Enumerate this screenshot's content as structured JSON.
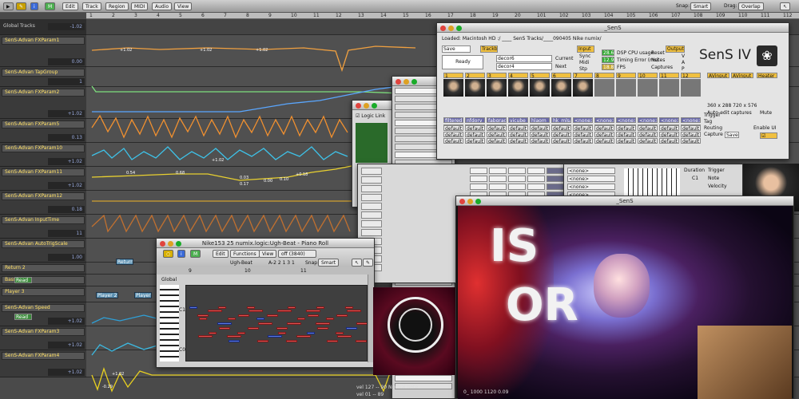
{
  "toolbar": {
    "edit": "Edit",
    "track": "Track",
    "region": "Region",
    "midi": "MIDI",
    "audio": "Audio",
    "view": "View",
    "snap_label": "Snap:",
    "snap_value": "Smart",
    "drag_label": "Drag:",
    "drag_value": "Overlap"
  },
  "ruler": {
    "bars": [
      "1",
      "2",
      "3",
      "4",
      "5",
      "6",
      "7",
      "8",
      "9",
      "10",
      "11",
      "12",
      "13",
      "14",
      "15",
      "16",
      "17",
      "18",
      "19",
      "20",
      "101",
      "102",
      "103",
      "104",
      "105",
      "106",
      "107",
      "108",
      "109",
      "110",
      "111",
      "112"
    ]
  },
  "global_tracks": "Global Tracks",
  "tracks": [
    {
      "name": "SenS-Advan  FXParam1",
      "value": "0.00"
    },
    {
      "name": "SenS-Advan  TapGroup",
      "value": "1"
    },
    {
      "name": "SenS-Advan  FXParam2",
      "value": "+1.02"
    },
    {
      "name": "SenS-Advan  FXParam5",
      "value": "0.13"
    },
    {
      "name": "SenS-Advan  FXParam10",
      "value": "+1.02"
    },
    {
      "name": "SenS-Advan  FXParam11",
      "value": "+1.02"
    },
    {
      "name": "SenS-Advan  FXParam12",
      "value": "0.18"
    },
    {
      "name": "SenS-Advan  InputTime",
      "value": "11"
    },
    {
      "name": "SenS-Advan  AutoTrigScale",
      "value": "1.00"
    },
    {
      "name": "Return 2",
      "value": ""
    },
    {
      "name": "Bass Hits",
      "value": ""
    },
    {
      "name": "Player 3",
      "value": ""
    },
    {
      "name": "SenS-Advan  Speed",
      "value": "+1.02"
    },
    {
      "name": "SenS-Advan  FXParam3",
      "value": "+1.02"
    },
    {
      "name": "SenS-Advan  FXParam4",
      "value": "+1.02"
    }
  ],
  "read_label": "Read",
  "region_labels": [
    "Return",
    "Player 2",
    "Player 2",
    "Player 3"
  ],
  "lane_values": [
    "+1.02",
    "+1.02",
    "+1.02",
    "0.00",
    "0.03",
    "0.17",
    "0.10",
    "+0.18",
    "0.54",
    "0.68",
    "+1.02",
    "-0.29",
    "+1.02"
  ],
  "sens_window": {
    "title": "_SenS",
    "loaded": "Loaded: Macintosh HD :/ ____ SenS Tracks/____090405 Nike numix/",
    "save": "Save",
    "ready": "Ready",
    "trackbank": "Trackbank",
    "current": "Current",
    "next": "Next",
    "decor1": "decor6",
    "decor2": "decor4",
    "val1": "63",
    "val2": "63",
    "input": "Input",
    "sync": "Sync",
    "midi": "Midi",
    "stp": "Stp",
    "dsp": "DSP CPU usage",
    "timing": "Timing Error (ms)",
    "fps": "FPS",
    "dsp_val": "28.6",
    "timing_val": "12.9",
    "fps_val": "18.8",
    "reset": "Reset",
    "notes": "Notes",
    "captures": "Captures",
    "output": "Output",
    "v": "V",
    "a": "A",
    "p": "P",
    "logo": "SenS IV",
    "channels": [
      "1",
      "2",
      "3",
      "4",
      "5",
      "6",
      "7",
      "8",
      "9",
      "10",
      "11",
      "12"
    ],
    "row_labels": [
      "filtered",
      "nfdory",
      "fabgrad",
      "vjcube",
      "hlaom",
      "hk_mlsas",
      "<none>",
      "<none>",
      "<none>",
      "<none>",
      "<none>",
      "<none>"
    ],
    "avin1": "AVinput 1",
    "avin2": "AVinput 2",
    "heater": "Heater",
    "res": "360 x 288  720 x 576",
    "auto": "Auto-edit captures",
    "mute": "Mute",
    "tag": "Tag",
    "routing": "Routing",
    "capture": "Capture",
    "enable": "Enable UI",
    "save_btn": "Save",
    "trigger": "Trigger",
    "default": "default"
  },
  "logic_link": "Logic Link",
  "piano_roll": {
    "title": "Nike153 25 numix.logic:Ugh-Beat - Piano Roll",
    "edit": "Edit",
    "functions": "Functions",
    "view": "View",
    "off": "off (3840)",
    "region": "Ugh-Beat",
    "pos": "A-2   2 1 3 1",
    "snap_label": "Snap:",
    "snap_value": "Smart",
    "global": "Global",
    "marker9": "9",
    "marker10": "10",
    "marker11": "11",
    "c1": "C1",
    "c0": "C0"
  },
  "sens_window2": {
    "title": "_SenS"
  },
  "video_text": {
    "line1": "IS",
    "line2": "OR"
  },
  "list_panel": {
    "rows": [
      "<none>",
      "<none>",
      "<none>",
      "<none>",
      "<none>"
    ],
    "duration": "Duration",
    "note": "Note",
    "velocity": "Velocity",
    "c1": "C1",
    "trigger": "Trigger"
  },
  "bottom": {
    "a": "vel 127 -- 90  Normal note",
    "b": "vel 01 -- 89",
    "c": "0_ 1000 1120 0.09"
  }
}
